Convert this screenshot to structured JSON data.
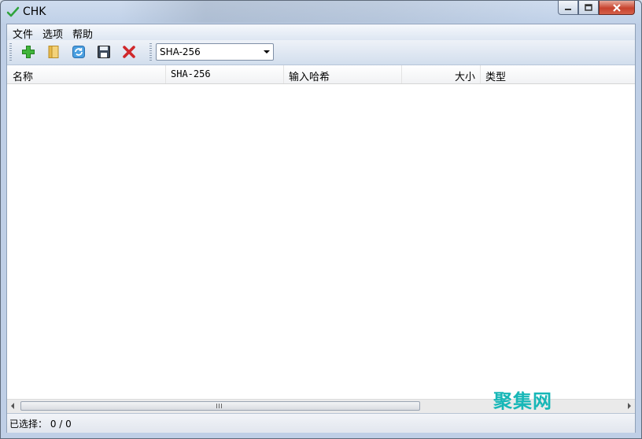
{
  "window": {
    "title": "CHK"
  },
  "menu": {
    "items": [
      "文件",
      "选项",
      "帮助"
    ]
  },
  "toolbar": {
    "buttons": [
      {
        "icon": "add-icon"
      },
      {
        "icon": "open-folder-icon"
      },
      {
        "icon": "refresh-icon"
      },
      {
        "icon": "save-icon"
      },
      {
        "icon": "delete-icon"
      }
    ],
    "algorithm_select": {
      "value": "SHA-256"
    }
  },
  "table": {
    "columns": [
      "名称",
      "SHA-256",
      "输入哈希",
      "大小",
      "类型"
    ],
    "rows": []
  },
  "scrollbar": {
    "grip": "III"
  },
  "status": {
    "text": "已选择： 0 / 0"
  },
  "watermark": {
    "text": "聚集网"
  },
  "colors": {
    "accent": "#17b7b7",
    "close": "#c7432e"
  }
}
